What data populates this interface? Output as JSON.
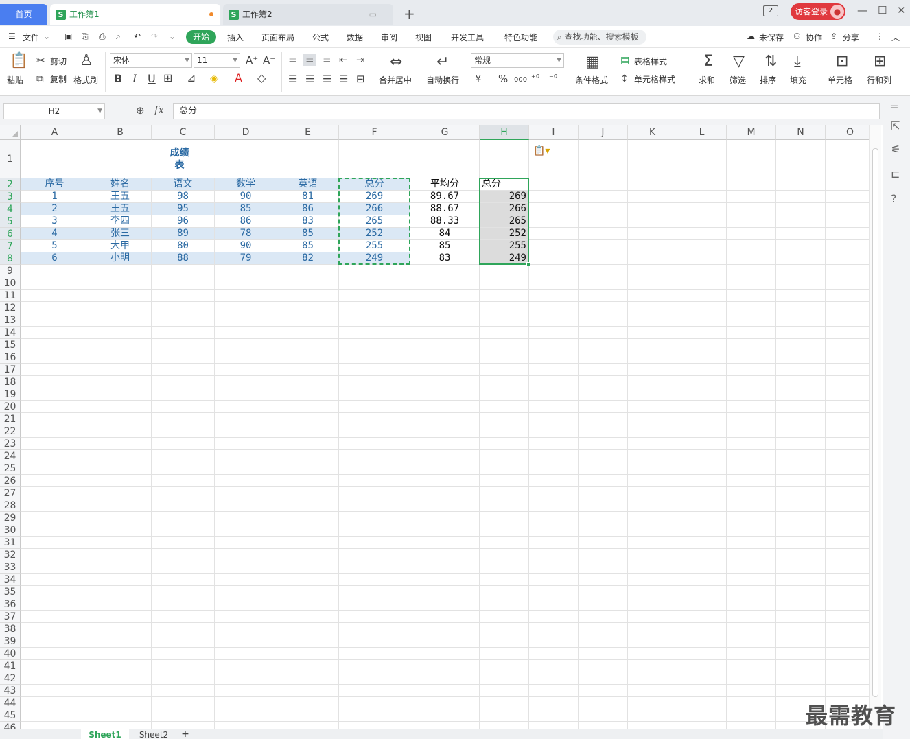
{
  "tabs": {
    "home": "首页",
    "wb1": "工作簿1",
    "wb2": "工作簿2",
    "new": "+"
  },
  "titlebar": {
    "tab_count": "2",
    "login": "访客登录"
  },
  "menu": {
    "file": "文件",
    "start": "开始",
    "items": [
      "插入",
      "页面布局",
      "公式",
      "数据",
      "审阅",
      "视图",
      "开发工具",
      "特色功能"
    ],
    "search": "查找功能、搜索模板",
    "unsaved": "未保存",
    "collab": "协作",
    "share": "分享"
  },
  "ribbon": {
    "paste": "粘贴",
    "cut": "剪切",
    "copy": "复制",
    "format_painter": "格式刷",
    "font": "宋体",
    "size": "11",
    "bold": "B",
    "italic": "I",
    "underline": "U",
    "merge": "合并居中",
    "wrap": "自动换行",
    "number_format": "常规",
    "currency": "¥",
    "percent": "%",
    "thousands": "000",
    "cond_format": "条件格式",
    "table_style": "表格样式",
    "cell_style": "单元格样式",
    "sum": "求和",
    "filter": "筛选",
    "sort": "排序",
    "fill": "填充",
    "cell": "单元格",
    "rowcol": "行和列"
  },
  "formula": {
    "name_box": "H2",
    "fx": "fx",
    "content": "总分"
  },
  "columns": [
    "A",
    "B",
    "C",
    "D",
    "E",
    "F",
    "G",
    "H",
    "I",
    "J",
    "K",
    "L",
    "M",
    "N",
    "O"
  ],
  "sheet": {
    "title": "成绩表",
    "headers": [
      "序号",
      "姓名",
      "语文",
      "数学",
      "英语",
      "总分",
      "平均分",
      "总分"
    ],
    "rows": [
      [
        "1",
        "王五",
        "98",
        "90",
        "81",
        "269",
        "89.67",
        "269"
      ],
      [
        "2",
        "王五",
        "95",
        "85",
        "86",
        "266",
        "88.67",
        "266"
      ],
      [
        "3",
        "李四",
        "96",
        "86",
        "83",
        "265",
        "88.33",
        "265"
      ],
      [
        "4",
        "张三",
        "89",
        "78",
        "85",
        "252",
        "84",
        "252"
      ],
      [
        "5",
        "大甲",
        "80",
        "90",
        "85",
        "255",
        "85",
        "255"
      ],
      [
        "6",
        "小明",
        "88",
        "79",
        "82",
        "249",
        "83",
        "249"
      ]
    ],
    "row_count": 46
  },
  "sheets": [
    "Sheet1",
    "Sheet2"
  ],
  "watermark": "最需教育",
  "colors": {
    "accent": "#2fa55a",
    "header_fill": "#dbe8f5",
    "header_text": "#2b6aa3",
    "title_text": "#2b6aa3"
  }
}
